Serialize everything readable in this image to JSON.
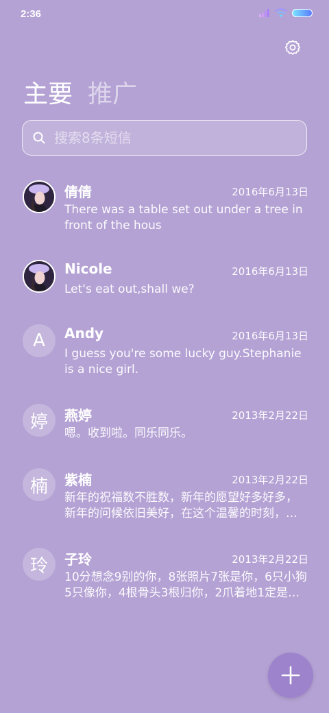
{
  "status_bar": {
    "time": "2:36",
    "signal_icon": "signal-icon",
    "wifi_icon": "wifi-icon",
    "battery_icon": "battery-icon"
  },
  "header": {
    "settings_icon": "gear-icon"
  },
  "tabs": [
    {
      "label": "主要",
      "active": true
    },
    {
      "label": "推广",
      "active": false
    }
  ],
  "search": {
    "placeholder": "搜索8条短信",
    "icon": "search-icon"
  },
  "conversations": [
    {
      "name": "倩倩",
      "date": "2016年6月13日",
      "preview": "There was a table set out under a tree in front of the hous",
      "avatar": "photo"
    },
    {
      "name": "Nicole",
      "date": "2016年6月13日",
      "preview": "Let's eat out,shall we?",
      "avatar": "photo"
    },
    {
      "name": "Andy",
      "date": "2016年6月13日",
      "preview": "I guess you're some lucky guy.Stephanie is a nice girl.",
      "avatar": "A"
    },
    {
      "name": "燕婷",
      "date": "2013年2月22日",
      "preview": "嗯。收到啦。同乐同乐。",
      "avatar": "婷"
    },
    {
      "name": "紫楠",
      "date": "2013年2月22日",
      "preview": "新年的祝福数不胜数，新年的愿望好多好多，新年的问候依旧美好，在这个温馨的时刻，…",
      "avatar": "楠"
    },
    {
      "name": "子玲",
      "date": "2013年2月22日",
      "preview": "10分想念9别的你，8张照片7张是你，6只小狗5只像你，4根骨头3根归你，2爪着地1定是…",
      "avatar": "玲"
    }
  ],
  "fab": {
    "icon": "plus-icon"
  },
  "colors": {
    "background": "#b4a2d4",
    "fab": "#9d83cc",
    "text": "#ffffff"
  }
}
